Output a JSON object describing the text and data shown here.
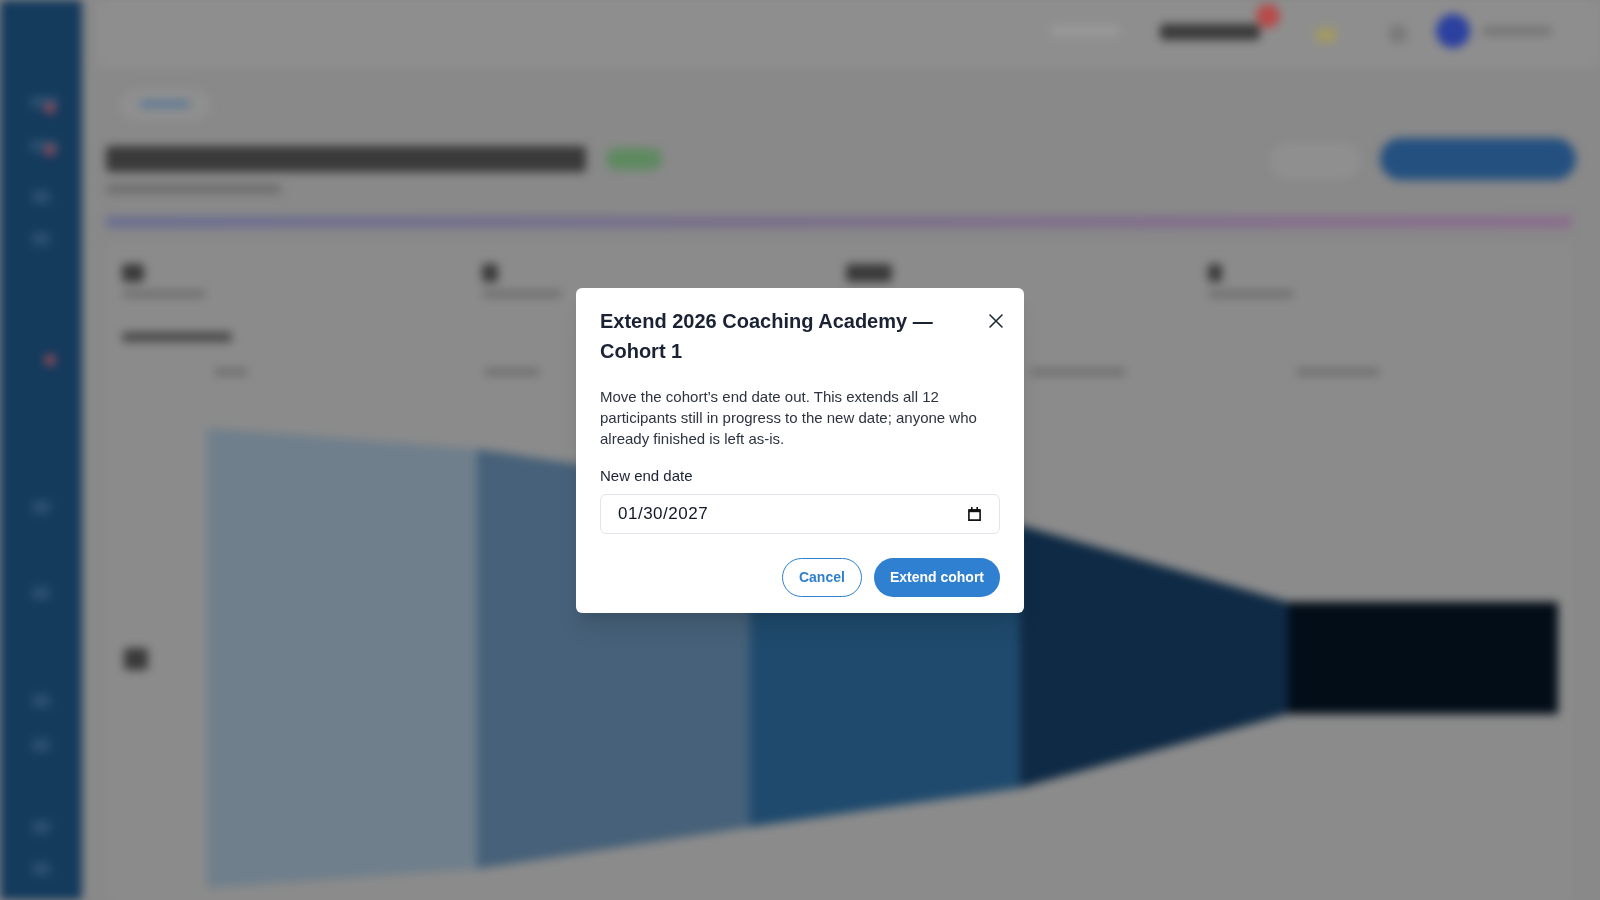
{
  "dialog": {
    "title": "Extend 2026 Coaching Academy — Cohort 1",
    "description": "Move the cohort’s end date out. This extends all 12 participants still in progress to the new date; anyone who already finished is left as-is.",
    "field": {
      "label": "New end date",
      "value": "01/30/2027"
    },
    "buttons": [
      {
        "label": "Cancel",
        "kind": "secondary"
      },
      {
        "label": "Extend cohort",
        "kind": "primary"
      }
    ]
  }
}
